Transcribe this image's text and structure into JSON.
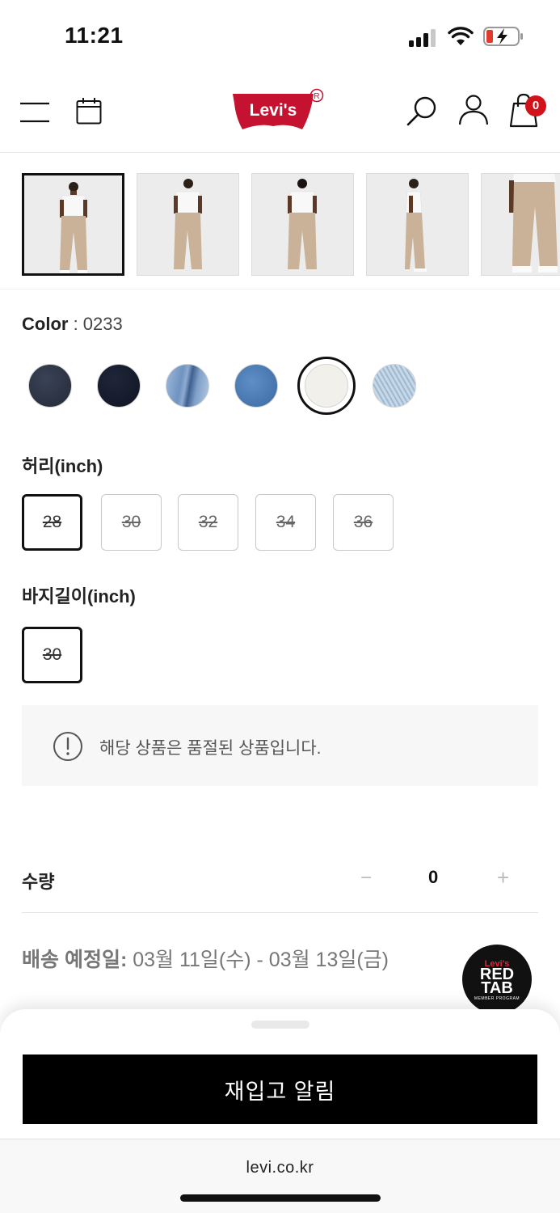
{
  "status_bar": {
    "time": "11:21"
  },
  "header": {
    "logo_text": "Levi's",
    "cart_count": "0",
    "icons": [
      "menu-icon",
      "calendar-icon",
      "search-icon",
      "user-icon",
      "shopping-bag-icon"
    ],
    "brand_color": "#c41230"
  },
  "gallery": {
    "thumbnail_count": 5,
    "selected_index": 0
  },
  "color": {
    "label": "Color",
    "separator": " : ",
    "value": "0233",
    "swatches": [
      {
        "name": "dark-denim",
        "color": "#2d3444"
      },
      {
        "name": "navy",
        "color": "#141a2a"
      },
      {
        "name": "light-wash-denim",
        "color": "#7fa0c8"
      },
      {
        "name": "medium-blue-denim",
        "color": "#4a78b0"
      },
      {
        "name": "ecru",
        "color": "#f2f0eb",
        "selected": true
      },
      {
        "name": "bleached-denim",
        "color": "#b9cfe0"
      }
    ]
  },
  "waist": {
    "label": "허리(inch)",
    "sizes": [
      "28",
      "30",
      "32",
      "34",
      "36"
    ],
    "selected": "28"
  },
  "length": {
    "label": "바지길이(inch)",
    "sizes": [
      "30"
    ],
    "selected": "30"
  },
  "notice": {
    "text": "해당 상품은 품절된 상품입니다."
  },
  "quantity": {
    "label": "수량",
    "minus": "−",
    "value": "0",
    "plus": "+"
  },
  "shipping": {
    "label": "배송 예정일:",
    "dates": " 03월 11일(수) - 03월 13일(금)"
  },
  "redtab_badge": {
    "brand": "Levi's",
    "line1": "RED",
    "line2": "TAB",
    "sub": "MEMBER PROGRAM"
  },
  "bottom_sheet": {
    "button_label": "재입고 알림"
  },
  "browser": {
    "url": "levi.co.kr"
  }
}
